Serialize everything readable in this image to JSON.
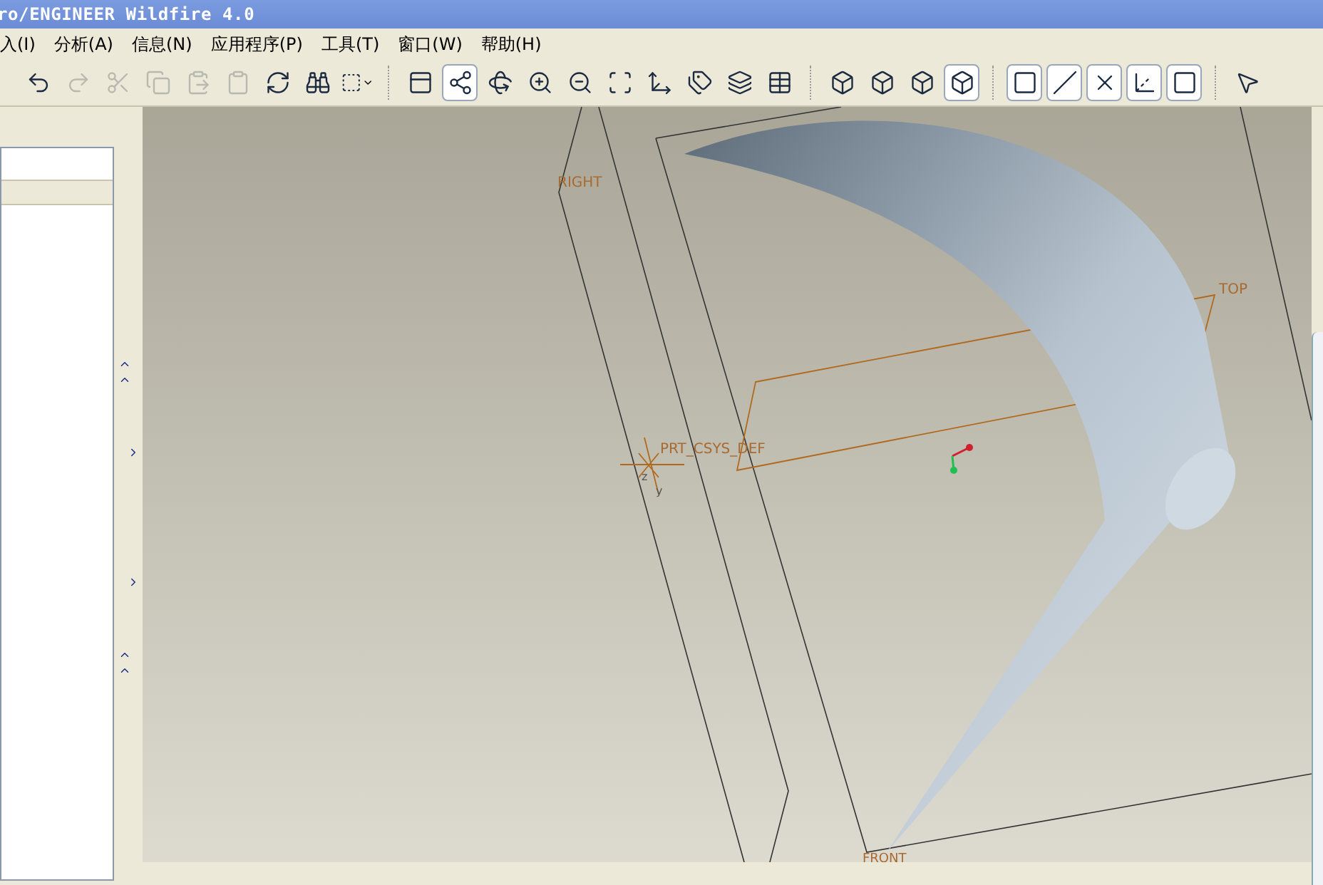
{
  "window": {
    "title": "ro/ENGINEER Wildfire 4.0"
  },
  "menu": [
    {
      "label": "入(I)"
    },
    {
      "label": "分析(A)"
    },
    {
      "label": "信息(N)"
    },
    {
      "label": "应用程序(P)"
    },
    {
      "label": "工具(T)"
    },
    {
      "label": "窗口(W)"
    },
    {
      "label": "帮助(H)"
    }
  ],
  "toolbar": [
    {
      "selected": false,
      "disabled": false
    },
    {
      "selected": false,
      "disabled": true
    },
    {
      "selected": false,
      "disabled": true
    },
    {
      "selected": false,
      "disabled": true
    },
    {
      "selected": false,
      "disabled": true
    },
    {
      "selected": false,
      "disabled": true
    },
    {
      "selected": false,
      "disabled": false
    },
    {
      "selected": false,
      "disabled": false
    },
    {
      "selected": false,
      "disabled": false
    },
    {
      "selected": false,
      "disabled": false
    },
    {
      "selected": true,
      "disabled": false
    },
    {
      "selected": false,
      "disabled": false
    },
    {
      "selected": false,
      "disabled": false
    },
    {
      "selected": false,
      "disabled": false
    },
    {
      "selected": false,
      "disabled": false
    },
    {
      "selected": false,
      "disabled": false
    },
    {
      "selected": false,
      "disabled": false
    },
    {
      "selected": false,
      "disabled": false
    },
    {
      "selected": false,
      "disabled": false
    },
    {
      "selected": false,
      "disabled": false
    },
    {
      "selected": false,
      "disabled": false
    },
    {
      "selected": false,
      "disabled": false
    },
    {
      "selected": true,
      "disabled": false
    },
    {
      "selected": true,
      "disabled": false
    },
    {
      "selected": true,
      "disabled": false
    },
    {
      "selected": true,
      "disabled": false
    },
    {
      "selected": true,
      "disabled": false
    },
    {
      "selected": true,
      "disabled": false
    },
    {
      "selected": false,
      "disabled": false
    }
  ],
  "canvas": {
    "datum_labels": [
      "RIGHT",
      "TOP",
      "PRT_CSYS_DEF",
      "FRONT"
    ],
    "csys_axes": [
      "z",
      "y"
    ]
  }
}
